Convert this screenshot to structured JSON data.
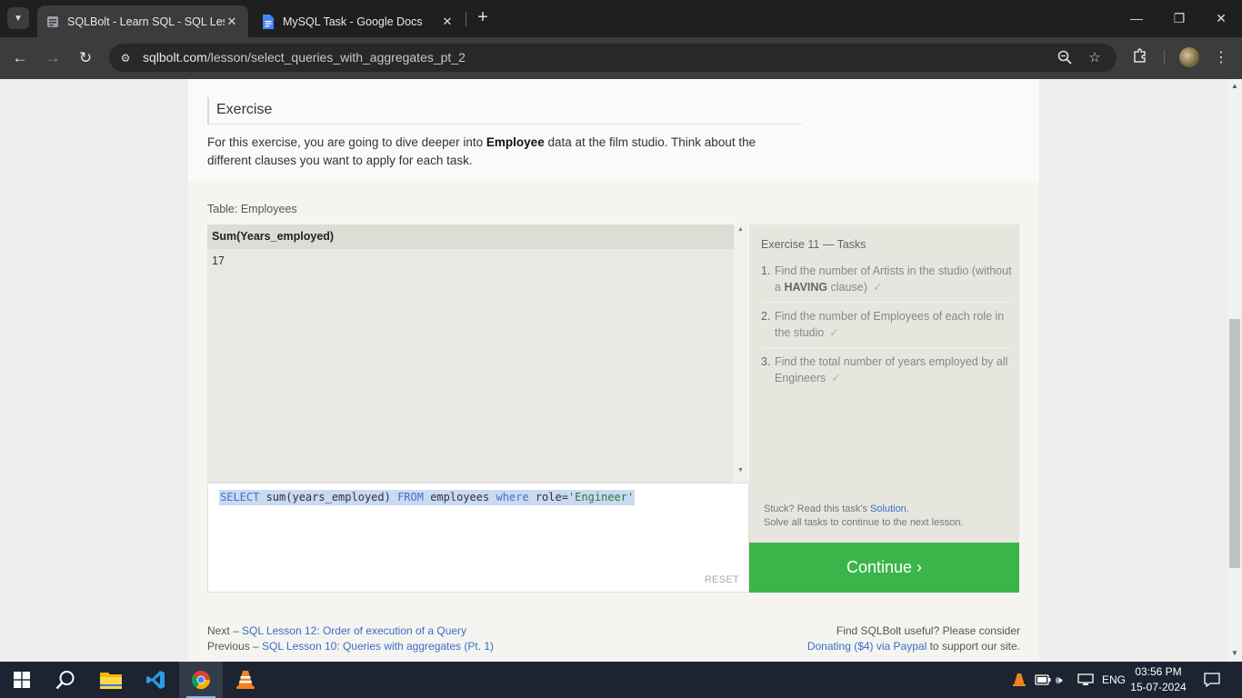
{
  "browser": {
    "tabs": [
      {
        "title": "SQLBolt - Learn SQL - SQL Less",
        "active": true
      },
      {
        "title": "MySQL Task - Google Docs",
        "active": false
      }
    ],
    "url_host": "sqlbolt.com",
    "url_path": "/lesson/select_queries_with_aggregates_pt_2"
  },
  "exercise": {
    "heading": "Exercise",
    "text_before": "For this exercise, you are going to dive deeper into ",
    "text_bold": "Employee",
    "text_after": " data at the film studio. Think about the different clauses you want to apply for each task."
  },
  "table": {
    "label": "Table: Employees",
    "columns": [
      "Sum(Years_employed)"
    ],
    "rows": [
      [
        "17"
      ]
    ]
  },
  "editor": {
    "query_parts": {
      "kw1": "SELECT",
      "fn": " sum(years_employed) ",
      "kw2": "FROM",
      "tbl": " employees ",
      "kw3": "where",
      "col": " role=",
      "str": "'Engineer'"
    },
    "reset_label": "RESET"
  },
  "tasks": {
    "title": "Exercise 11 — Tasks",
    "items": [
      {
        "num": "1.",
        "text": "Find the number of Artists in the studio (without a ",
        "bold": "HAVING",
        "after": " clause)",
        "check": "✓"
      },
      {
        "num": "2.",
        "text": "Find the number of Employees of each role in the studio",
        "check": "✓"
      },
      {
        "num": "3.",
        "text": "Find the total number of years employed by all Engineers",
        "check": "✓"
      }
    ],
    "stuck_prefix": "Stuck? Read this task's ",
    "stuck_link": "Solution",
    "stuck_suffix": ".",
    "stuck_line2": "Solve all tasks to continue to the next lesson.",
    "continue_label": "Continue ›"
  },
  "footer": {
    "next_prefix": "Next – ",
    "next_link": "SQL Lesson 12: Order of execution of a Query",
    "prev_prefix": "Previous – ",
    "prev_link": "SQL Lesson 10: Queries with aggregates (Pt. 1)",
    "support_line1": "Find SQLBolt useful? Please consider",
    "support_link": "Donating ($4) via Paypal",
    "support_suffix": " to support our site."
  },
  "taskbar": {
    "lang": "ENG",
    "time": "03:56 PM",
    "date": "15-07-2024"
  },
  "colors": {
    "continue_bg": "#3bb54a",
    "link": "#3a6ec4",
    "selection": "#c9daf4"
  }
}
